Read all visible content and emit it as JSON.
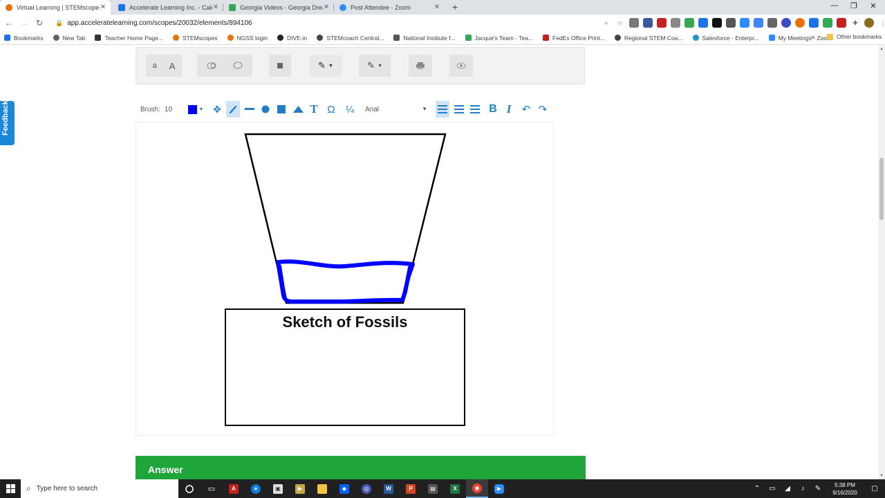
{
  "browser": {
    "tabs": [
      {
        "title": "Virtual Learning | STEMscopes",
        "active": true,
        "favicon_color": "#e8710a"
      },
      {
        "title": "Accelerate Learning Inc. - Calendar",
        "active": false,
        "favicon_color": "#1a73e8"
      },
      {
        "title": "Georgia Videos - Georgia Dreams",
        "active": false,
        "favicon_color": "#34a853"
      },
      {
        "title": "Post Attendee - Zoom",
        "active": false,
        "favicon_color": "#2d8cff"
      }
    ],
    "new_tab_label": "+",
    "window_controls": {
      "minimize": "—",
      "restore": "❐",
      "close": "✕"
    },
    "url": "app.acceleratelearning.com/scopes/20032/elements/894106",
    "bookmarks": [
      {
        "label": "Bookmarks",
        "color": "#1a73e8"
      },
      {
        "label": "New Tab",
        "color": "#5f6368"
      },
      {
        "label": "Teacher Home Page...",
        "color": "#333"
      },
      {
        "label": "STEMscopes",
        "color": "#e8710a"
      },
      {
        "label": "NGSS login",
        "color": "#e8710a"
      },
      {
        "label": "DIVE-in",
        "color": "#222"
      },
      {
        "label": "STEMcoach Central...",
        "color": "#444"
      },
      {
        "label": "National Institute f...",
        "color": "#555"
      },
      {
        "label": "Jacque's Team - Tea...",
        "color": "#34a853"
      },
      {
        "label": "FedEx Office Print...",
        "color": "#c5221f"
      },
      {
        "label": "Regional STEM Coa...",
        "color": "#444"
      },
      {
        "label": "Salesforce - Enterpr...",
        "color": "#1798c1"
      },
      {
        "label": "My Meetings - Zoom",
        "color": "#2d8cff"
      }
    ],
    "bookmarks_more": "»",
    "other_bookmarks": "Other bookmarks"
  },
  "editor": {
    "feedback_label": "Feedback",
    "top_toolbar": {
      "text_small": "a",
      "text_large": "A"
    },
    "draw_toolbar": {
      "brush_label": "Brush:",
      "brush_size": "10",
      "color": "#0000ff",
      "font": "Arial",
      "text_tool": "T",
      "omega_tool": "Ω",
      "fraction_tool": "¼",
      "bold": "B",
      "italic": "I"
    },
    "sketch_title": "Sketch of Fossils",
    "answer_label": "Answer"
  },
  "taskbar": {
    "search_placeholder": "Type here to search",
    "time": "5:38 PM",
    "date": "9/16/2020"
  }
}
